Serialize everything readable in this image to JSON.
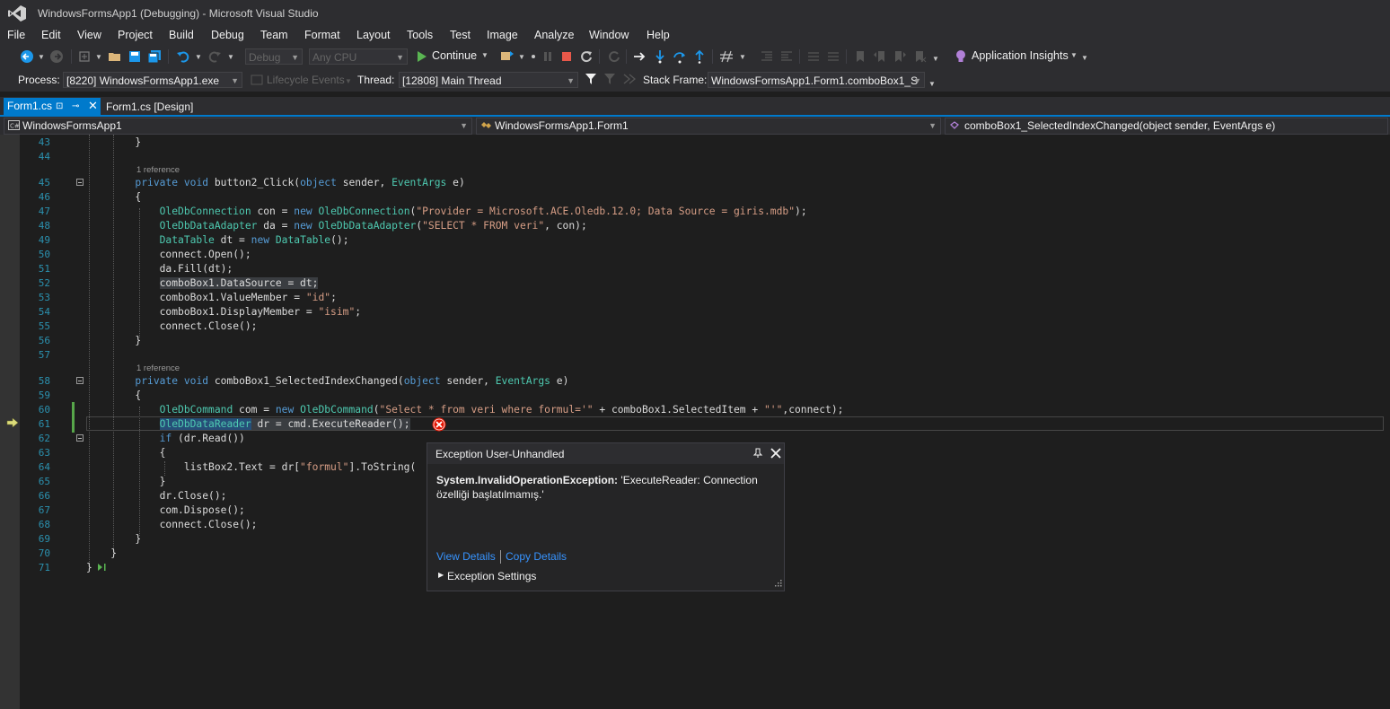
{
  "window": {
    "title": "WindowsFormsApp1 (Debugging) - Microsoft Visual Studio"
  },
  "menu": [
    "File",
    "Edit",
    "View",
    "Project",
    "Build",
    "Debug",
    "Team",
    "Format",
    "Layout",
    "Tools",
    "Test",
    "Image",
    "Analyze",
    "Window",
    "Help"
  ],
  "toolbar": {
    "config": "Debug",
    "platform": "Any CPU",
    "continue_label": "Continue",
    "app_insights_label": "Application Insights"
  },
  "debug_location": {
    "process_label": "Process:",
    "process_value": "[8220] WindowsFormsApp1.exe",
    "lifecycle_label": "Lifecycle Events",
    "thread_label": "Thread:",
    "thread_value": "[12808] Main Thread",
    "stack_label": "Stack Frame:",
    "stack_value": "WindowsFormsApp1.Form1.comboBox1_S"
  },
  "tabs": {
    "active": "Form1.cs",
    "inactive": "Form1.cs [Design]"
  },
  "navbar": {
    "project": "WindowsFormsApp1",
    "class": "WindowsFormsApp1.Form1",
    "member": "comboBox1_SelectedIndexChanged(object sender, EventArgs e)"
  },
  "editor": {
    "line_numbers": [
      "43",
      "44",
      "45",
      "46",
      "47",
      "48",
      "49",
      "50",
      "51",
      "52",
      "53",
      "54",
      "55",
      "56",
      "57",
      "58",
      "59",
      "60",
      "61",
      "62",
      "63",
      "64",
      "65",
      "66",
      "67",
      "68",
      "69",
      "70",
      "71"
    ],
    "references": [
      "1 reference",
      "1 reference"
    ]
  },
  "exception": {
    "title": "Exception User-Unhandled",
    "type": "System.InvalidOperationException:",
    "message": " 'ExecuteReader: Connection özelliği başlatılmamış.'",
    "view_details": "View Details",
    "copy_details": "Copy Details",
    "settings": "Exception Settings"
  }
}
